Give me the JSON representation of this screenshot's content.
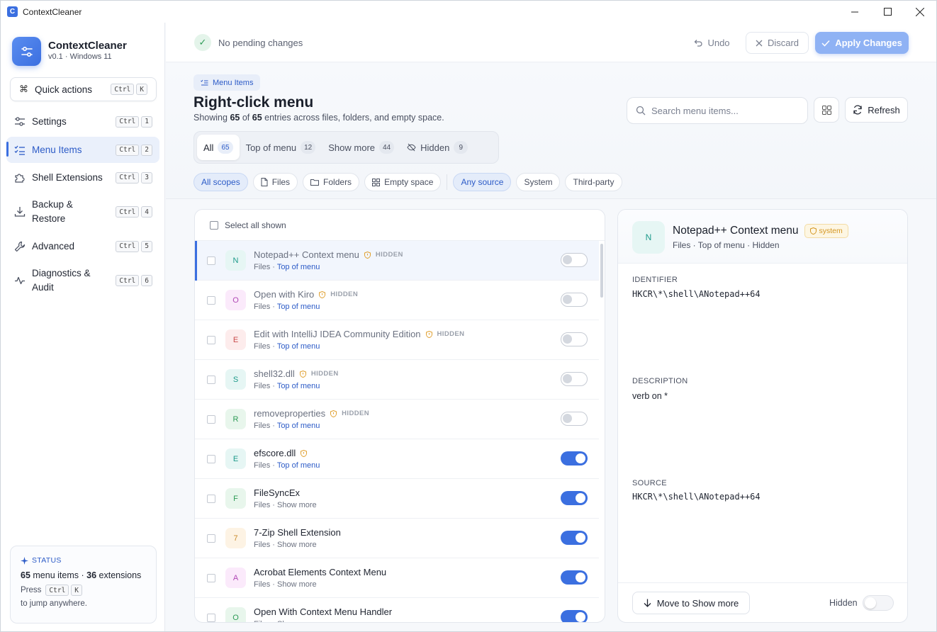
{
  "window": {
    "title": "ContextCleaner"
  },
  "sidebar": {
    "brand_name": "ContextCleaner",
    "brand_version": "v0.1 · Windows 11",
    "quick_actions": {
      "label": "Quick actions",
      "keys": [
        "Ctrl",
        "K"
      ]
    },
    "nav": [
      {
        "label": "Settings",
        "keys": [
          "Ctrl",
          "1"
        ],
        "icon": "sliders-icon"
      },
      {
        "label": "Menu Items",
        "keys": [
          "Ctrl",
          "2"
        ],
        "icon": "list-check-icon",
        "active": true
      },
      {
        "label": "Shell Extensions",
        "keys": [
          "Ctrl",
          "3"
        ],
        "icon": "puzzle-icon"
      },
      {
        "label": "Backup & Restore",
        "keys": [
          "Ctrl",
          "4"
        ],
        "icon": "download-icon"
      },
      {
        "label": "Advanced",
        "keys": [
          "Ctrl",
          "5"
        ],
        "icon": "wrench-icon"
      },
      {
        "label": "Diagnostics & Audit",
        "keys": [
          "Ctrl",
          "6"
        ],
        "icon": "activity-icon"
      }
    ],
    "status": {
      "heading": "STATUS",
      "menu_items_count": "65",
      "menu_items_label": "menu items ·",
      "extensions_count": "36",
      "extensions_label": "extensions",
      "press_label": "Press",
      "keys": [
        "Ctrl",
        "K"
      ],
      "jump_label": "to jump anywhere."
    }
  },
  "topbar": {
    "pending_text": "No pending changes",
    "undo_label": "Undo",
    "discard_label": "Discard",
    "apply_label": "Apply Changes"
  },
  "header": {
    "breadcrumb": "Menu Items",
    "title": "Right-click menu",
    "subtitle_prefix": "Showing",
    "shown_count": "65",
    "subtitle_of": "of",
    "total_count": "65",
    "subtitle_suffix": "entries across files, folders, and empty space.",
    "search_placeholder": "Search menu items...",
    "refresh_label": "Refresh",
    "tabs": [
      {
        "label": "All",
        "count": "65",
        "active": true
      },
      {
        "label": "Top of menu",
        "count": "12"
      },
      {
        "label": "Show more",
        "count": "44"
      },
      {
        "label": "Hidden",
        "count": "9"
      }
    ],
    "scope_chips": [
      {
        "label": "All scopes",
        "on": true
      },
      {
        "label": "Files",
        "icon": "file-icon"
      },
      {
        "label": "Folders",
        "icon": "folder-icon"
      },
      {
        "label": "Empty space",
        "icon": "grid-icon"
      }
    ],
    "source_chips": [
      {
        "label": "Any source",
        "on": true
      },
      {
        "label": "System"
      },
      {
        "label": "Third-party"
      }
    ]
  },
  "list": {
    "select_all_label": "Select all shown",
    "rows": [
      {
        "letter": "N",
        "name": "Notepad++ Context menu",
        "hidden_tag": "HIDDEN",
        "shield": true,
        "scope": "Files",
        "location": "Top of menu",
        "enabled": false,
        "selected": true,
        "av_bg": "#e6f6f4",
        "av_fg": "#1d9a8a"
      },
      {
        "letter": "O",
        "name": "Open with Kiro",
        "hidden_tag": "HIDDEN",
        "shield": true,
        "scope": "Files",
        "location": "Top of menu",
        "enabled": false,
        "av_bg": "#fbeafb",
        "av_fg": "#b048b5"
      },
      {
        "letter": "E",
        "name": "Edit with IntelliJ IDEA Community Edition",
        "hidden_tag": "HIDDEN",
        "shield": true,
        "scope": "Files",
        "location": "Top of menu",
        "enabled": false,
        "av_bg": "#fdecec",
        "av_fg": "#c94a4a"
      },
      {
        "letter": "S",
        "name": "shell32.dll",
        "hidden_tag": "HIDDEN",
        "shield": true,
        "scope": "Files",
        "location": "Top of menu",
        "enabled": false,
        "av_bg": "#e6f6f4",
        "av_fg": "#1d9a8a"
      },
      {
        "letter": "R",
        "name": "removeproperties",
        "hidden_tag": "HIDDEN",
        "shield": true,
        "scope": "Files",
        "location": "Top of menu",
        "enabled": false,
        "av_bg": "#e8f6ec",
        "av_fg": "#2e9b57"
      },
      {
        "letter": "E",
        "name": "efscore.dll",
        "hidden_tag": "",
        "shield": true,
        "scope": "Files",
        "location": "Top of menu",
        "enabled": true,
        "av_bg": "#e6f6f4",
        "av_fg": "#1d9a8a"
      },
      {
        "letter": "F",
        "name": "FileSyncEx",
        "hidden_tag": "",
        "shield": false,
        "scope": "Files",
        "location": "Show more",
        "enabled": true,
        "av_bg": "#e8f6ec",
        "av_fg": "#2e9b57"
      },
      {
        "letter": "7",
        "name": "7-Zip Shell Extension",
        "hidden_tag": "",
        "shield": false,
        "scope": "Files",
        "location": "Show more",
        "enabled": true,
        "av_bg": "#fdf3e4",
        "av_fg": "#c98a2a"
      },
      {
        "letter": "A",
        "name": "Acrobat Elements Context Menu",
        "hidden_tag": "",
        "shield": false,
        "scope": "Files",
        "location": "Show more",
        "enabled": true,
        "av_bg": "#fbeafb",
        "av_fg": "#b048b5"
      },
      {
        "letter": "O",
        "name": "Open With Context Menu Handler",
        "hidden_tag": "",
        "shield": false,
        "scope": "Files",
        "location": "Show more",
        "enabled": true,
        "av_bg": "#e8f6ec",
        "av_fg": "#2e9b57"
      }
    ]
  },
  "detail": {
    "letter": "N",
    "name": "Notepad++ Context menu",
    "badge": "system",
    "meta": "Files · Top of menu · Hidden",
    "identifier_label": "IDENTIFIER",
    "identifier": "HKCR\\*\\shell\\ANotepad++64",
    "description_label": "DESCRIPTION",
    "description": "verb on *",
    "source_label": "SOURCE",
    "source": "HKCR\\*\\shell\\ANotepad++64",
    "move_label": "Move to Show more",
    "hidden_label": "Hidden"
  },
  "colors": {
    "accent": "#3b6fe0",
    "apply_disabled": "#8fb2f4",
    "warning": "#e0a030"
  }
}
